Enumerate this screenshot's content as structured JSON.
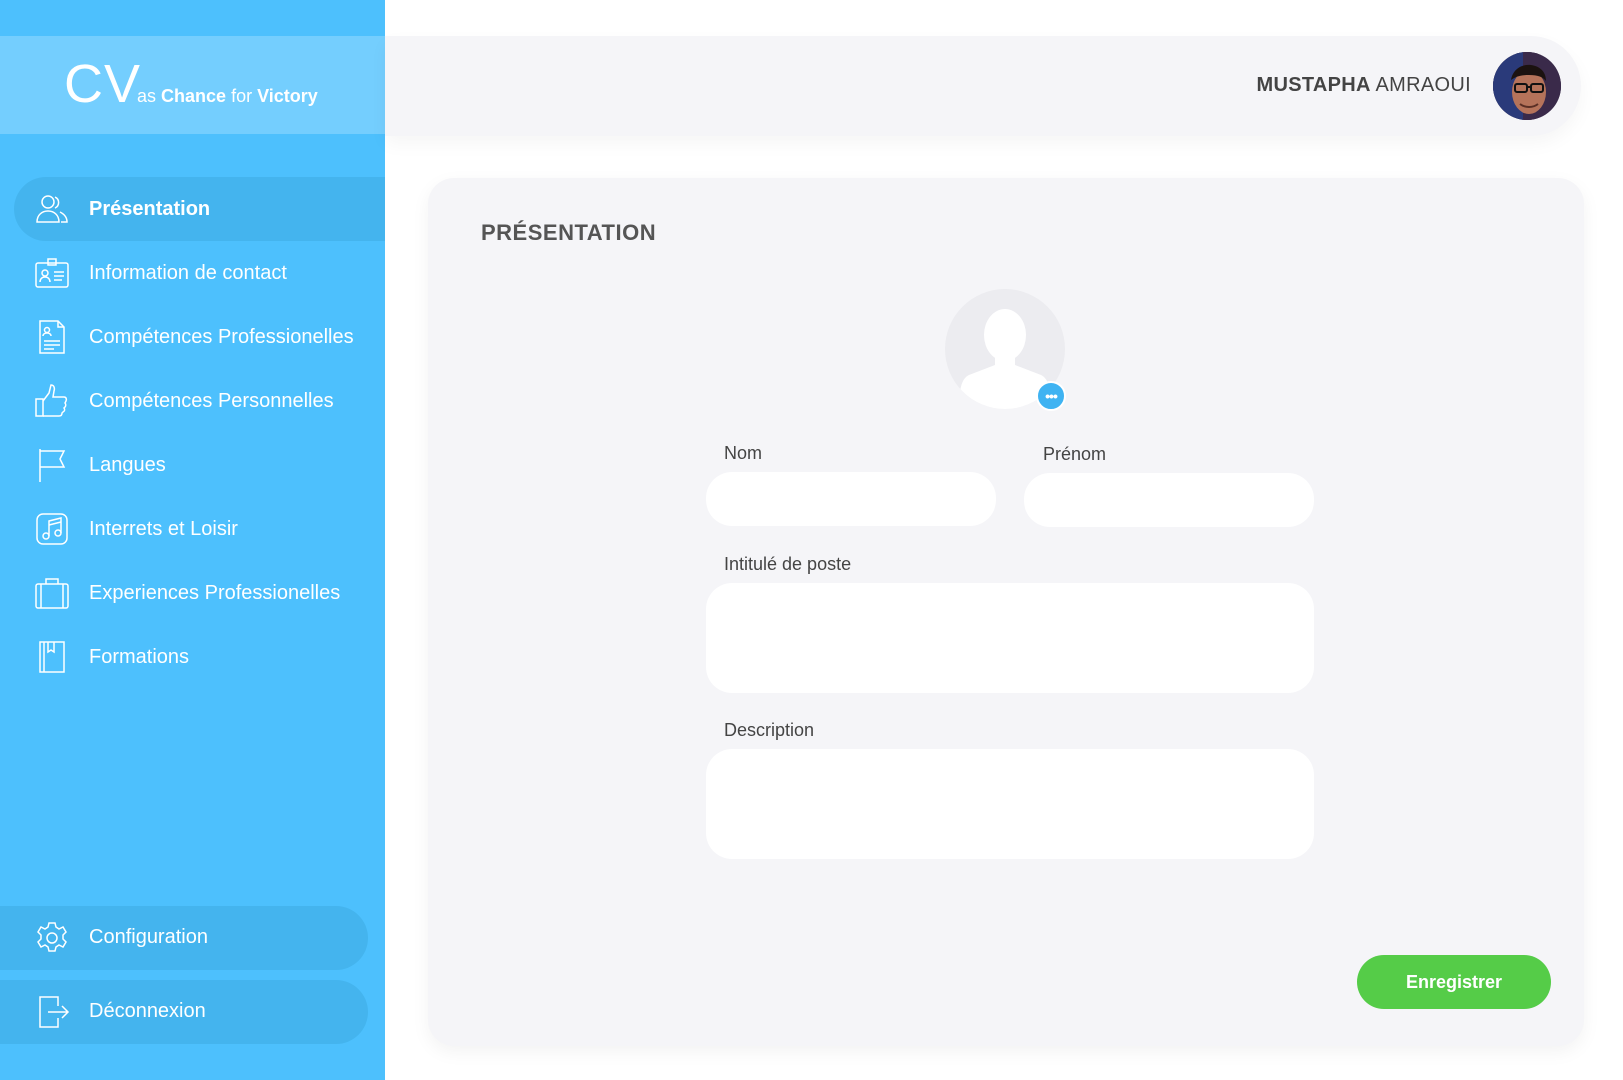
{
  "logo": {
    "cv": "CV",
    "as": "as",
    "chance": "Chance",
    "for": "for",
    "victory": "Victory"
  },
  "sidebar": {
    "items": [
      {
        "label": "Présentation",
        "icon": "users-icon",
        "active": true
      },
      {
        "label": "Information de contact",
        "icon": "id-card-icon",
        "active": false
      },
      {
        "label": "Compétences Professionelles",
        "icon": "document-icon",
        "active": false
      },
      {
        "label": "Compétences Personnelles",
        "icon": "thumbs-up-icon",
        "active": false
      },
      {
        "label": "Langues",
        "icon": "flag-icon",
        "active": false
      },
      {
        "label": "Interrets et Loisir",
        "icon": "music-icon",
        "active": false
      },
      {
        "label": "Experiences Professionelles",
        "icon": "briefcase-icon",
        "active": false
      },
      {
        "label": "Formations",
        "icon": "book-icon",
        "active": false
      }
    ],
    "configuration": "Configuration",
    "logout": "Déconnexion"
  },
  "header": {
    "first_name": "MUSTAPHA",
    "last_name": "AMRAOUI"
  },
  "form": {
    "title": "PRÉSENTATION",
    "nom_label": "Nom",
    "prenom_label": "Prénom",
    "intitule_label": "Intitulé de poste",
    "description_label": "Description",
    "nom_value": "",
    "prenom_value": "",
    "intitule_value": "",
    "description_value": "",
    "photo_more": "•••",
    "save_label": "Enregistrer"
  },
  "colors": {
    "sidebar": "#4dc0fd",
    "active": "#44b4ee",
    "save": "#55cc48",
    "accent": "#3fb3f2"
  }
}
